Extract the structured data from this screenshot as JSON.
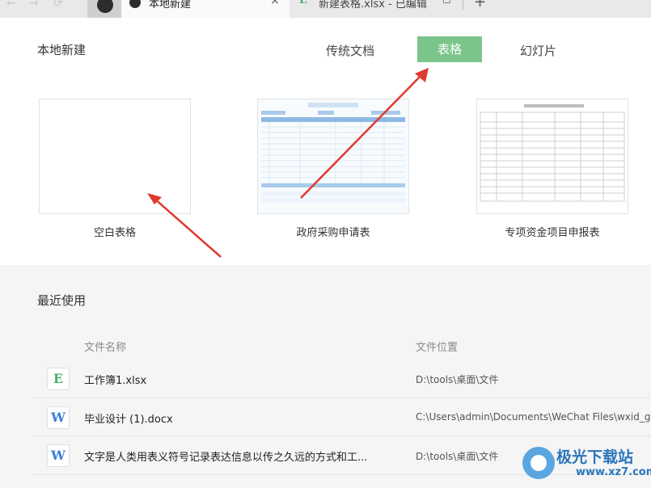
{
  "tabs": {
    "active": {
      "label": "本地新建",
      "close_glyph": "×"
    },
    "second": {
      "label": "新建表格.xlsx - 已编辑",
      "icon_letter": "E"
    },
    "add_glyph": "+"
  },
  "header": {
    "title": "本地新建",
    "categories": [
      {
        "label": "传统文档",
        "active": false
      },
      {
        "label": "表格",
        "active": true
      },
      {
        "label": "幻灯片",
        "active": false
      }
    ]
  },
  "templates": [
    {
      "label": "空白表格"
    },
    {
      "label": "政府采购申请表"
    },
    {
      "label": "专项资金项目申报表"
    }
  ],
  "recent": {
    "title": "最近使用",
    "columns": {
      "name": "文件名称",
      "location": "文件位置"
    },
    "files": [
      {
        "icon_letter": "E",
        "icon_color": "#4cae6c",
        "name": "工作簿1.xlsx",
        "path": "D:\\tools\\桌面\\文件"
      },
      {
        "icon_letter": "W",
        "icon_color": "#3c7fd6",
        "name": "毕业设计 (1).docx",
        "path": "C:\\Users\\admin\\Documents\\WeChat Files\\wxid_gn"
      },
      {
        "icon_letter": "W",
        "icon_color": "#3c7fd6",
        "name": "文字是人类用表义符号记录表达信息以传之久远的方式和工...",
        "path": "D:\\tools\\桌面\\文件"
      }
    ]
  },
  "watermark": {
    "name": "极光下载站",
    "url": "www.xz7.com"
  },
  "colors": {
    "accent": "#7cc58a",
    "arrow": "#e03a2e"
  }
}
